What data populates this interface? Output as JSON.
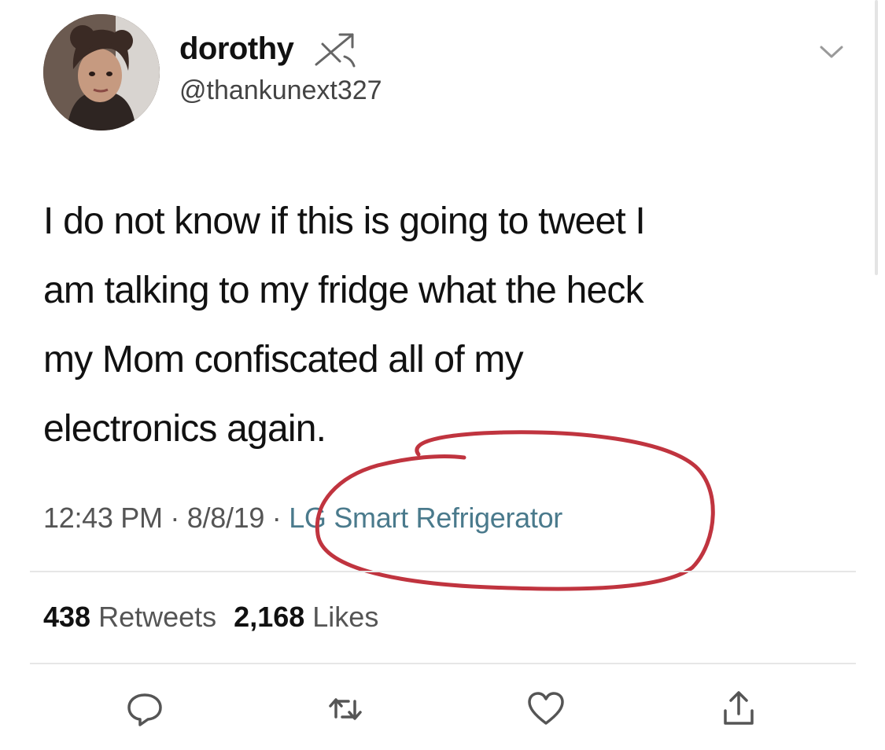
{
  "user": {
    "display_name": "dorothy",
    "handle": "@thankunext327",
    "badge_icon": "sagittarius-icon"
  },
  "tweet": {
    "lines": [
      "I do not know if this is going to tweet I",
      "am talking to my fridge what the heck",
      "my Mom confiscated all of my",
      "electronics again."
    ],
    "time": "12:43 PM",
    "separator": " · ",
    "date": "8/8/19",
    "source_separator": " · ",
    "source": "LG Smart Refrigerator"
  },
  "stats": {
    "retweets_count": "438",
    "retweets_label": "Retweets",
    "likes_count": "2,168",
    "likes_label": "Likes"
  },
  "actions": [
    "reply-icon",
    "retweet-icon",
    "like-icon",
    "share-icon"
  ],
  "colors": {
    "source_link": "#4a7a8c",
    "annotation_circle": "#c0343f",
    "icon_gray": "#555555"
  }
}
